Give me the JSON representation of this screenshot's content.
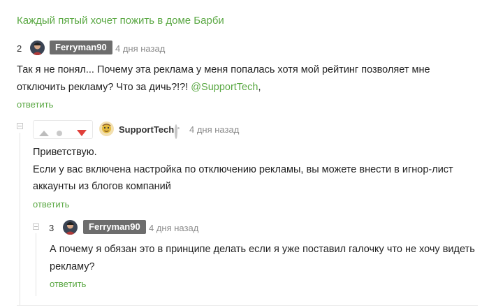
{
  "post": {
    "title": "Каждый пятый хочет пожить в доме Барби"
  },
  "comments": [
    {
      "rating": "2",
      "author": "Ferryman90",
      "time": "4 дня назад",
      "text_line1": "Так я не понял... Почему эта реклама у меня попалась хотя мой рейтинг позволяет мне",
      "text_line2": "отключить рекламу? Что за дичь?!?! ",
      "mention": "@SupportTech",
      "text_end": ",",
      "reply_label": "ответить"
    },
    {
      "author": "SupportTech",
      "time": "4 дня назад",
      "text_line1": "Приветствую.",
      "text_line2": "Если у вас включена настройка по отключению рекламы, вы можете внести в игнор-лист",
      "text_line3": "аккаунты из блогов компаний",
      "reply_label": "ответить"
    },
    {
      "rating": "3",
      "author": "Ferryman90",
      "time": "4 дня назад",
      "text_line1": "А почему я обязан это в принципе делать если я уже поставил галочку что не хочу видеть",
      "text_line2": "рекламу?",
      "reply_label": "ответить"
    }
  ],
  "icons": {
    "upvote": "upvote-triangle-icon",
    "neutral": "dot-icon",
    "downvote": "downvote-triangle-icon",
    "corporate": "corporate-badge-icon"
  },
  "colors": {
    "accent_green": "#5aa843",
    "badge_gray": "#6d6d6d",
    "downvote_red": "#e0403a",
    "meta_gray": "#8b8b8b"
  }
}
